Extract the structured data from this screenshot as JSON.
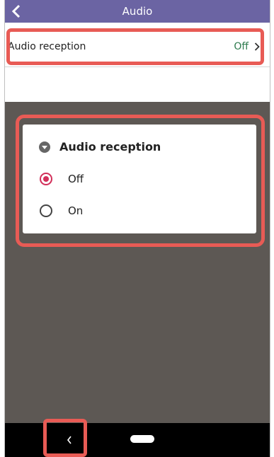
{
  "appbar": {
    "title": "Audio",
    "back_icon": "chevron-left-icon",
    "color": "#6b64a3"
  },
  "settings": {
    "row_label": "Audio reception",
    "row_value": "Off"
  },
  "dialog": {
    "title": "Audio reception",
    "title_icon": "collapse-circle-icon",
    "options": [
      {
        "label": "Off",
        "selected": true
      },
      {
        "label": "On",
        "selected": false
      }
    ],
    "accent": "#d2305a"
  },
  "navbar": {
    "back_icon": "nav-back-icon",
    "home_icon": "nav-home-pill-icon"
  },
  "highlight_color": "#e85b55"
}
